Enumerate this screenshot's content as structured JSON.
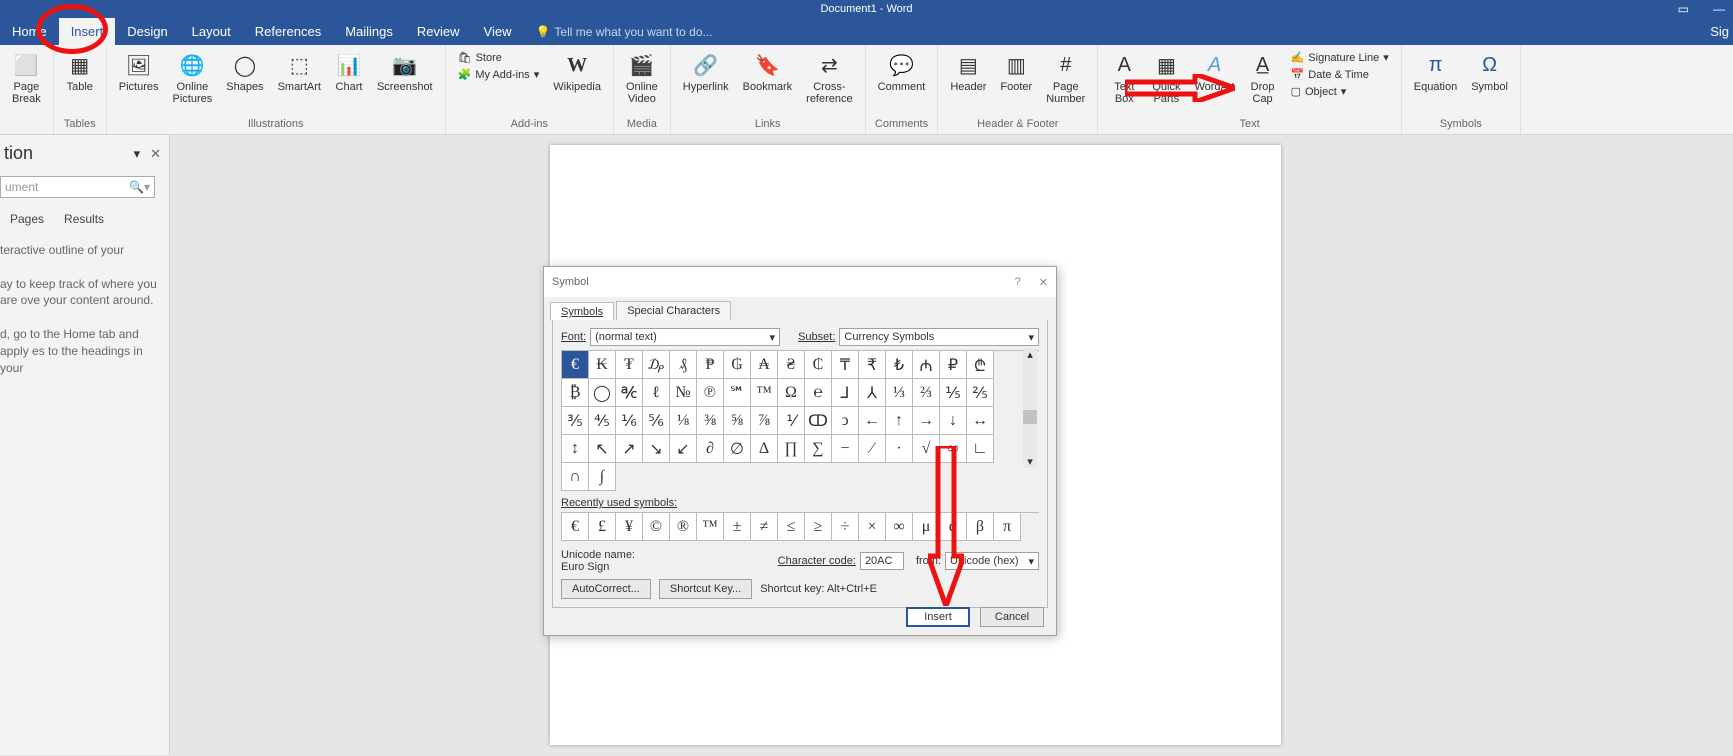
{
  "window": {
    "title": "Document1 - Word",
    "sign_in": "Sig"
  },
  "tabs": [
    "Home",
    "Insert",
    "Design",
    "Layout",
    "References",
    "Mailings",
    "Review",
    "View"
  ],
  "tell_me": "Tell me what you want to do...",
  "ribbon": {
    "groups": {
      "pages": {
        "label": "",
        "page_break": "Page\nBreak"
      },
      "tables": {
        "label": "Tables",
        "table": "Table"
      },
      "illustrations": {
        "label": "Illustrations",
        "pictures": "Pictures",
        "online_pictures": "Online\nPictures",
        "shapes": "Shapes",
        "smartart": "SmartArt",
        "chart": "Chart",
        "screenshot": "Screenshot"
      },
      "addins": {
        "label": "Add-ins",
        "store": "Store",
        "my_addins": "My Add-ins",
        "wikipedia": "Wikipedia"
      },
      "media": {
        "label": "Media",
        "online_video": "Online\nVideo"
      },
      "links": {
        "label": "Links",
        "hyperlink": "Hyperlink",
        "bookmark": "Bookmark",
        "crossref": "Cross-\nreference"
      },
      "comments": {
        "label": "Comments",
        "comment": "Comment"
      },
      "headerfooter": {
        "label": "Header & Footer",
        "header": "Header",
        "footer": "Footer",
        "page_number": "Page\nNumber"
      },
      "text": {
        "label": "Text",
        "textbox": "Text\nBox",
        "quick_parts": "Quick\nParts",
        "wordart": "WordArt",
        "drop_cap": "Drop\nCap",
        "sig": "Signature Line",
        "date": "Date & Time",
        "object": "Object"
      },
      "symbols": {
        "label": "Symbols",
        "equation": "Equation",
        "symbol": "Symbol"
      }
    }
  },
  "nav": {
    "title": "tion",
    "search": "ument",
    "tabs": [
      "Pages",
      "Results"
    ],
    "body": "teractive outline of your\n\nay to keep track of where you are ove your content around.\n\nd, go to the Home tab and apply es to the headings in your"
  },
  "dialog": {
    "title": "Symbol",
    "tabs": [
      "Symbols",
      "Special Characters"
    ],
    "font_label": "Font:",
    "font_value": "(normal text)",
    "subset_label": "Subset:",
    "subset_value": "Currency Symbols",
    "symbols": [
      "€",
      "₭",
      "₮",
      "₯",
      "₰",
      "₱",
      "₲",
      "₳",
      "₴",
      "₵",
      "₸",
      "₹",
      "₺",
      "₼",
      "₽",
      "₾",
      "₿",
      "◯",
      "℀",
      "ℓ",
      "№",
      "℗",
      "℠",
      "™",
      "Ω",
      "℮",
      "⅃",
      "⅄",
      "⅓",
      "⅔",
      "⅕",
      "⅖",
      "⅗",
      "⅘",
      "⅙",
      "⅚",
      "⅛",
      "⅜",
      "⅝",
      "⅞",
      "⅟",
      "ↀ",
      "ↄ",
      "←",
      "↑",
      "→",
      "↓",
      "↔",
      "↕",
      "↖",
      "↗",
      "↘",
      "↙",
      "∂",
      "∅",
      "∆",
      "∏",
      "∑",
      "−",
      "∕",
      "∙",
      "√",
      "∞",
      "∟",
      "∩",
      "∫"
    ],
    "recent_label": "Recently used symbols:",
    "recent": [
      "€",
      "£",
      "¥",
      "©",
      "®",
      "™",
      "±",
      "≠",
      "≤",
      "≥",
      "÷",
      "×",
      "∞",
      "μ",
      "α",
      "β",
      "π"
    ],
    "unicode_name_label": "Unicode name:",
    "unicode_name": "Euro Sign",
    "char_code_label": "Character code:",
    "char_code": "20AC",
    "from_label": "from:",
    "from_value": "Unicode (hex)",
    "autocorrect": "AutoCorrect...",
    "shortcut_key_btn": "Shortcut Key...",
    "shortcut_key_label": "Shortcut key: Alt+Ctrl+E",
    "insert": "Insert",
    "cancel": "Cancel"
  }
}
